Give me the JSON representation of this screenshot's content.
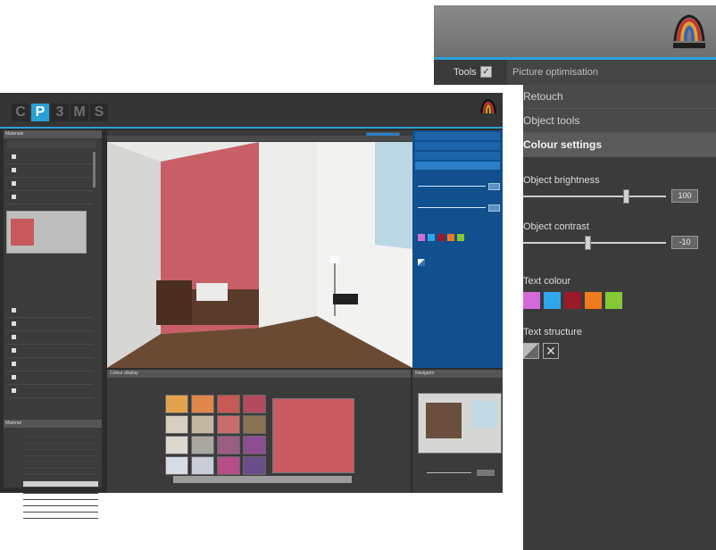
{
  "zoom_panel": {
    "tools_label": "Tools",
    "tools_checked": "✓",
    "tab_picture_optimisation": "Picture optimisation",
    "sections": [
      "Retouch",
      "Object tools",
      "Colour settings"
    ],
    "brightness_label": "Object brightness",
    "brightness_value": "100",
    "brightness_level": 0.72,
    "contrast_label": "Object contrast",
    "contrast_value": "-10",
    "contrast_level": 0.45,
    "text_colour_label": "Text colour",
    "text_colours": [
      "#d36ad8",
      "#2fa6ea",
      "#9a1a2a",
      "#f07a1e",
      "#86c834"
    ],
    "text_structure_label": "Text structure"
  },
  "main_window": {
    "logo_letters": [
      "C",
      "P",
      "3",
      "M",
      "S"
    ],
    "active_logo_letter_index": 1,
    "left_panel_title": "Materials",
    "materials_title": "Material",
    "bottom_panel_title": "Colour display",
    "navigator_title": "Navigator",
    "materials_list_selected_index": 8,
    "materials_list_count": 14,
    "palette_tiles": [
      "#e2a24e",
      "#e2874c",
      "#c85a55",
      "#b44a5e",
      "#d8cfc0",
      "#c4b8a2",
      "#c96d6a",
      "#8a7354",
      "#dcd8d0",
      "#a8a7a2",
      "#9a5e84",
      "#8c4e92",
      "#d6dce4",
      "#c9cdd6",
      "#b64d88",
      "#6a4e8a"
    ],
    "swatch_colours": [
      "#d36ad8",
      "#2fa6ea",
      "#9a1a2a",
      "#f07a1e",
      "#86c834"
    ]
  }
}
